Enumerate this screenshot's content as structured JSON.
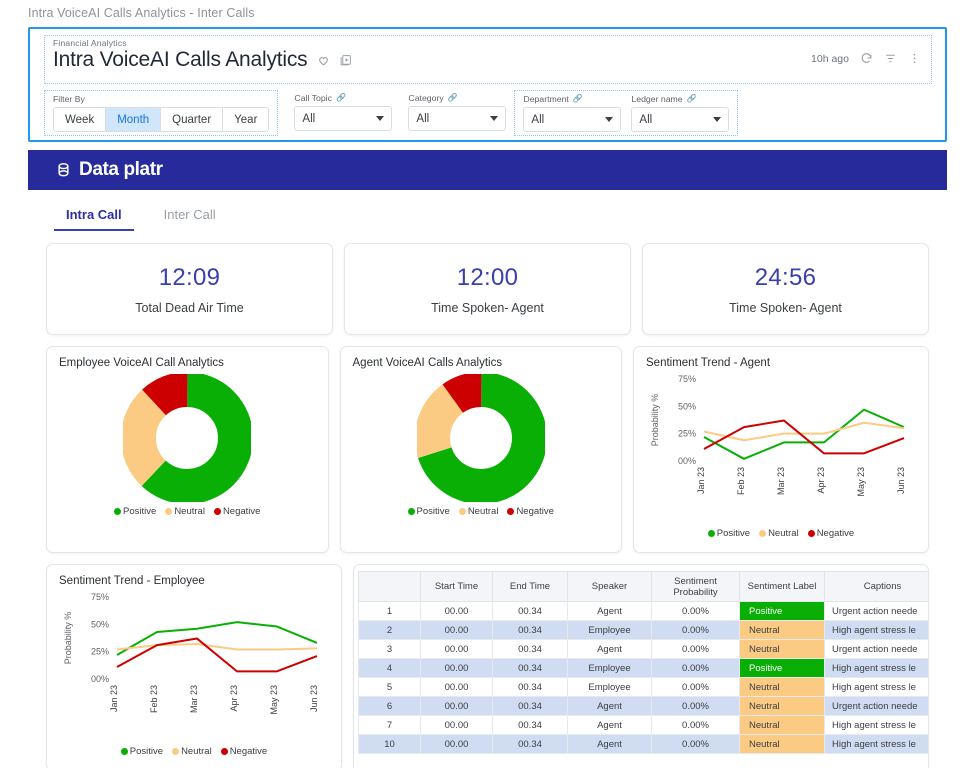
{
  "window": {
    "title": "Intra VoiceAI Calls Analytics - Inter Calls"
  },
  "header": {
    "breadcrumb": "Financial Analytics",
    "title": "Intra VoiceAI Calls Analytics",
    "favorite_icon": "heart-icon",
    "add_icon": "add-to-collection-icon",
    "updated": "10h ago",
    "refresh_icon": "refresh-icon",
    "filter_icon": "filter-icon",
    "more_icon": "kebab-menu-icon"
  },
  "filters": {
    "filter_by_label": "Filter By",
    "periods": [
      "Week",
      "Month",
      "Quarter",
      "Year"
    ],
    "active_period": "Month",
    "dropdowns": [
      {
        "label": "Call Topic",
        "value": "All"
      },
      {
        "label": "Category",
        "value": "All"
      },
      {
        "label": "Department",
        "value": "All"
      },
      {
        "label": "Ledger name",
        "value": "All"
      }
    ]
  },
  "brand": {
    "name": "Data platr",
    "logo_icon": "database-logo-icon",
    "color": "#262a9b"
  },
  "tabs": [
    {
      "label": "Intra Call",
      "active": true
    },
    {
      "label": "Inter Call",
      "active": false
    }
  ],
  "kpis": [
    {
      "value": "12:09",
      "label": "Total Dead Air Time"
    },
    {
      "value": "12:00",
      "label": "Time Spoken- Agent"
    },
    {
      "value": "24:56",
      "label": "Time Spoken- Agent"
    }
  ],
  "legend": [
    {
      "name": "Positive",
      "color": "#0aaf06"
    },
    {
      "name": "Neutral",
      "color": "#fbcb84"
    },
    {
      "name": "Negative",
      "color": "#cc0000"
    }
  ],
  "chart_data": [
    {
      "type": "pie",
      "title": "Employee VoiceAI Call Analytics",
      "labels": [
        "Positive",
        "Neutral",
        "Negative"
      ],
      "values": [
        62,
        26,
        12
      ],
      "colors": [
        "#0aaf06",
        "#fbcb84",
        "#cc0000"
      ],
      "legend_position": "bottom"
    },
    {
      "type": "pie",
      "title": "Agent VoiceAI Calls Analytics",
      "labels": [
        "Positive",
        "Neutral",
        "Negative"
      ],
      "values": [
        70,
        20,
        10
      ],
      "colors": [
        "#0aaf06",
        "#fbcb84",
        "#cc0000"
      ],
      "legend_position": "bottom"
    },
    {
      "type": "line",
      "title": "Sentiment Trend - Agent",
      "xlabel": "",
      "ylabel": "Probability %",
      "categories": [
        "Jan 23",
        "Feb 23",
        "Mar 23",
        "Apr 23",
        "May 23",
        "Jun 23"
      ],
      "yticks": [
        "00%",
        "25%",
        "50%",
        "75%"
      ],
      "ylim": [
        0,
        75
      ],
      "grid": false,
      "legend_position": "bottom",
      "series": [
        {
          "name": "Positive",
          "color": "#0aaf06",
          "values": [
            22,
            2,
            17,
            17,
            47,
            31
          ]
        },
        {
          "name": "Neutral",
          "color": "#fbcb84",
          "values": [
            27,
            19,
            25,
            25,
            35,
            30
          ]
        },
        {
          "name": "Negative",
          "color": "#cc0000",
          "values": [
            11,
            31,
            37,
            7,
            7,
            21
          ]
        }
      ]
    },
    {
      "type": "line",
      "title": "Sentiment Trend - Employee",
      "xlabel": "",
      "ylabel": "Probability %",
      "categories": [
        "Jan 23",
        "Feb 23",
        "Mar 23",
        "Apr 23",
        "May 23",
        "Jun 23"
      ],
      "yticks": [
        "00%",
        "25%",
        "50%",
        "75%"
      ],
      "ylim": [
        0,
        75
      ],
      "grid": false,
      "legend_position": "bottom",
      "series": [
        {
          "name": "Positive",
          "color": "#0aaf06",
          "values": [
            22,
            43,
            46,
            52,
            48,
            33
          ]
        },
        {
          "name": "Neutral",
          "color": "#fbcb84",
          "values": [
            27,
            31,
            32,
            27,
            27,
            28
          ]
        },
        {
          "name": "Negative",
          "color": "#cc0000",
          "values": [
            11,
            31,
            37,
            7,
            7,
            21
          ]
        }
      ]
    }
  ],
  "table": {
    "columns": [
      "",
      "Start Time",
      "End Time",
      "Speaker",
      "Sentiment Probability",
      "Sentiment Label",
      "Captions"
    ],
    "rows": [
      {
        "n": "1",
        "start": "00.00",
        "end": "00.34",
        "speaker": "Agent",
        "prob": "0.00%",
        "label": "Positive",
        "caption": "Urgent action neede"
      },
      {
        "n": "2",
        "start": "00.00",
        "end": "00.34",
        "speaker": "Employee",
        "prob": "0.00%",
        "label": "Neutral",
        "caption": "High agent stress le"
      },
      {
        "n": "3",
        "start": "00.00",
        "end": "00.34",
        "speaker": "Agent",
        "prob": "0.00%",
        "label": "Neutral",
        "caption": "Urgent action neede"
      },
      {
        "n": "4",
        "start": "00.00",
        "end": "00.34",
        "speaker": "Employee",
        "prob": "0.00%",
        "label": "Positive",
        "caption": "High agent stress le"
      },
      {
        "n": "5",
        "start": "00.00",
        "end": "00.34",
        "speaker": "Employee",
        "prob": "0.00%",
        "label": "Neutral",
        "caption": "High agent stress le"
      },
      {
        "n": "6",
        "start": "00.00",
        "end": "00.34",
        "speaker": "Agent",
        "prob": "0.00%",
        "label": "Neutral",
        "caption": "Urgent action neede"
      },
      {
        "n": "7",
        "start": "00.00",
        "end": "00.34",
        "speaker": "Agent",
        "prob": "0.00%",
        "label": "Neutral",
        "caption": "High agent stress le"
      },
      {
        "n": "10",
        "start": "00.00",
        "end": "00.34",
        "speaker": "Agent",
        "prob": "0.00%",
        "label": "Neutral",
        "caption": "High agent stress le"
      }
    ]
  }
}
